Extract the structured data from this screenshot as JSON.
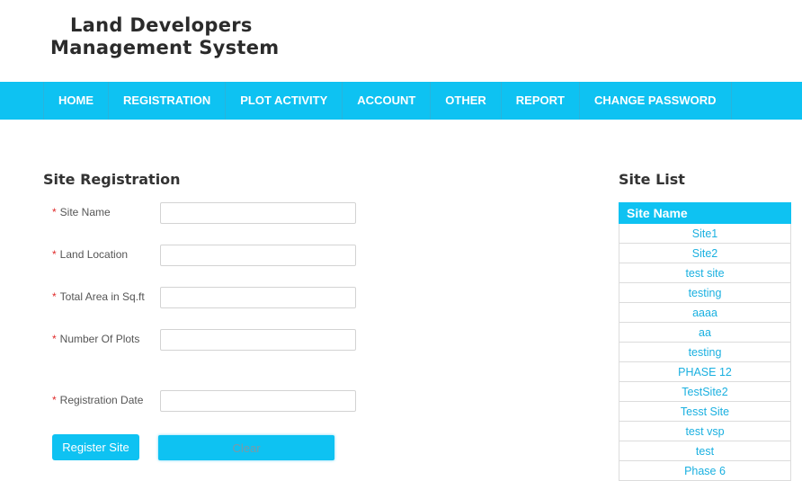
{
  "header": {
    "logo_line1": "Land Developers",
    "logo_line2": "Management System"
  },
  "nav": {
    "items": [
      "HOME",
      "REGISTRATION",
      "PLOT ACTIVITY",
      "ACCOUNT",
      "OTHER",
      "REPORT",
      "CHANGE PASSWORD"
    ]
  },
  "form": {
    "title": "Site Registration",
    "required_mark": "*",
    "fields": [
      {
        "label": "Site Name",
        "value": ""
      },
      {
        "label": "Land Location",
        "value": ""
      },
      {
        "label": "Total Area in Sq.ft",
        "value": ""
      },
      {
        "label": "Number Of Plots",
        "value": ""
      },
      {
        "label": "Registration Date",
        "value": ""
      }
    ],
    "register_label": "Register Site",
    "clear_label": "Clear"
  },
  "site_list": {
    "title": "Site List",
    "column_header": "Site Name",
    "rows": [
      "Site1",
      "Site2",
      "test site",
      "testing",
      "aaaa",
      "aa",
      "testing",
      "PHASE 12",
      "TestSite2",
      "Tesst Site",
      "test vsp",
      "test",
      "Phase 6"
    ]
  },
  "colors": {
    "accent": "#0ec2f2",
    "link": "#1ab0e0",
    "required": "#e02a2a"
  }
}
